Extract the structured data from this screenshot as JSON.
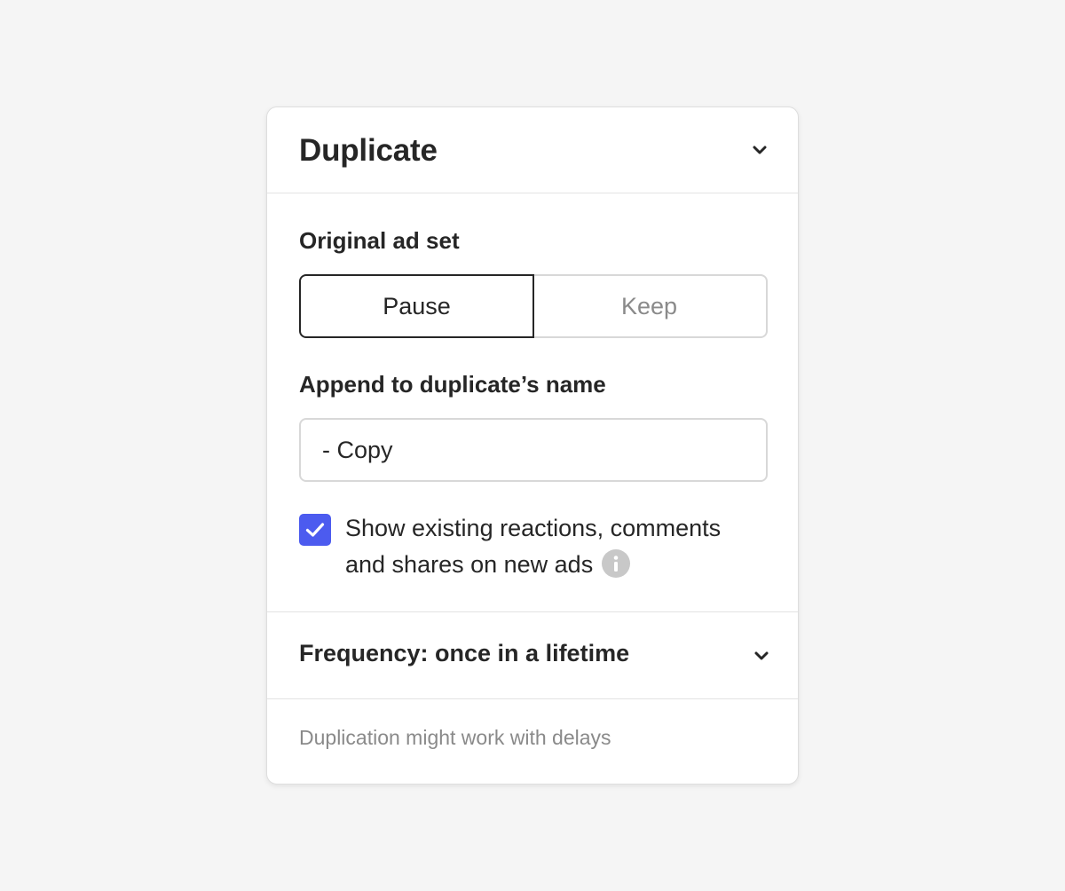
{
  "panel": {
    "title": "Duplicate",
    "collapse_icon": "chevron-down-icon"
  },
  "original_ad_set": {
    "label": "Original ad set",
    "options": [
      "Pause",
      "Keep"
    ],
    "selected": "Pause"
  },
  "append_name": {
    "label": "Append to duplicate’s name",
    "value": "- Copy"
  },
  "show_reactions": {
    "checked": true,
    "label": "Show existing reactions, comments and shares on new ads",
    "info_icon": "info-icon"
  },
  "frequency": {
    "label": "Frequency: once in a lifetime",
    "expand_icon": "chevron-down-icon"
  },
  "footer": {
    "note": "Duplication might work with delays"
  },
  "colors": {
    "accent": "#4c5bef",
    "text": "#262626",
    "muted": "#8a8a8a",
    "border": "#d8d8d8",
    "background": "#f5f5f5"
  }
}
